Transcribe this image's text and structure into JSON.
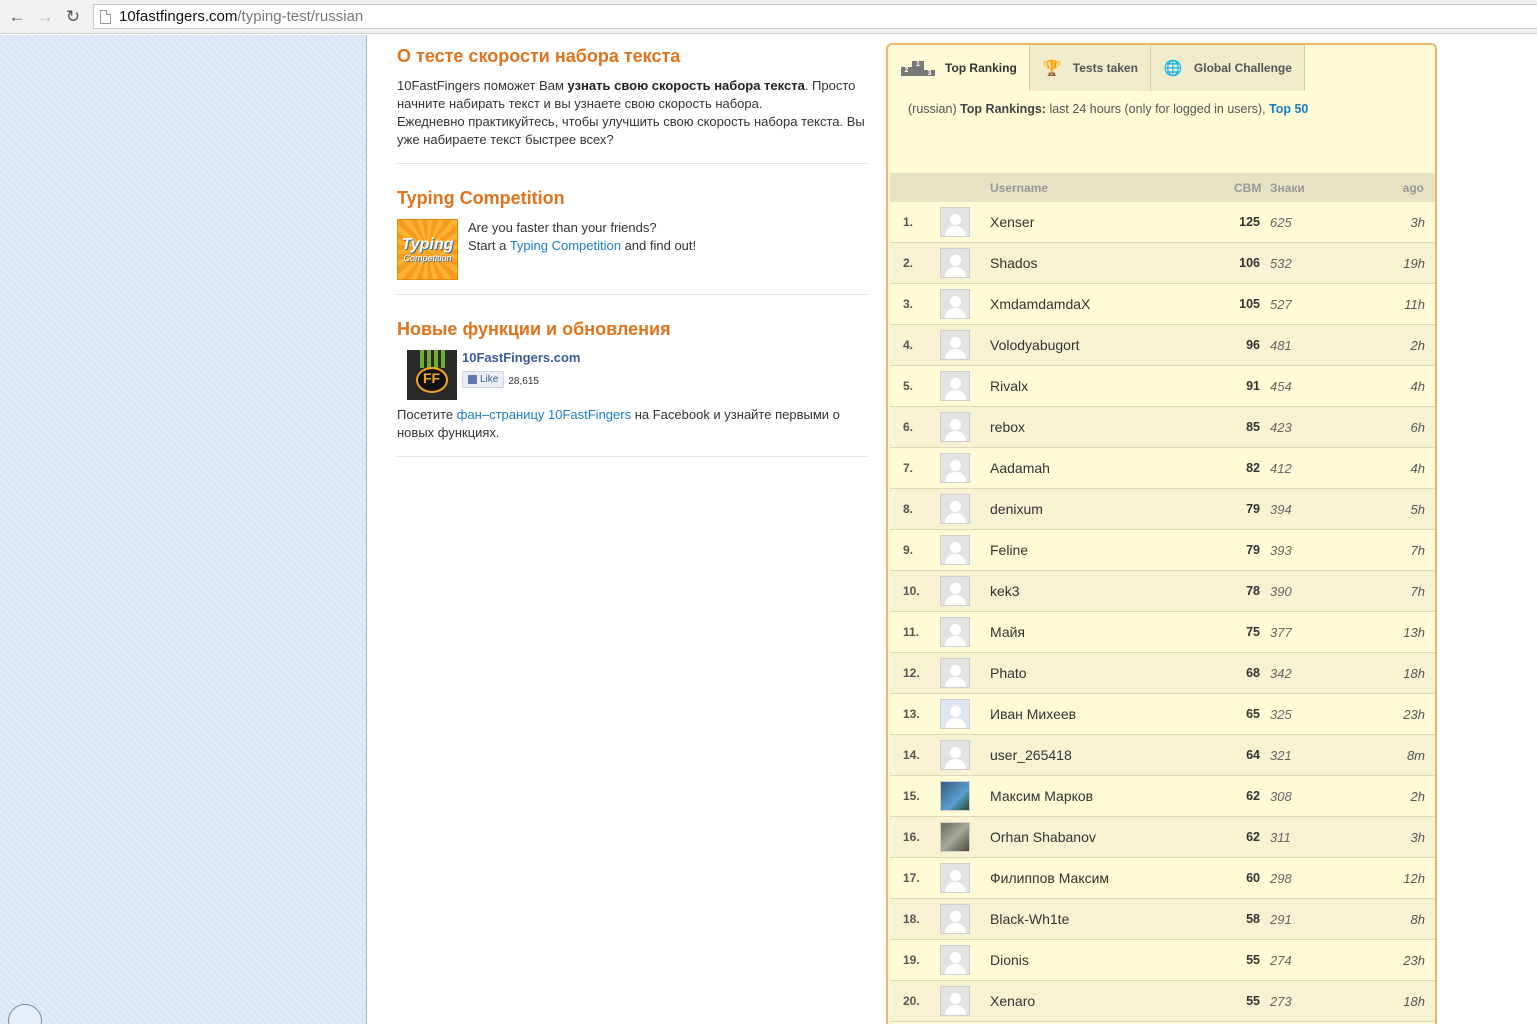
{
  "browser": {
    "url_host": "10fastfingers.com",
    "url_path": "/typing-test/russian"
  },
  "about": {
    "title": "О тесте скорости набора текста",
    "p1_start": "10FastFingers поможет Вам ",
    "p1_bold": "узнать свою скорость набора текста",
    "p1_end": ". Просто начните набирать текст и вы узнаете свою скорость набора.",
    "p2": "Ежедневно практикуйтесь, чтобы улучшить свою скорость набора текста. Вы уже набираете текст быстрее всех?"
  },
  "competition": {
    "title": "Typing Competition",
    "logo_line1": "Typing",
    "logo_line2": "Competition",
    "line1": "Are you faster than your friends?",
    "line2_start": "Start a ",
    "line2_link": "Typing Competition",
    "line2_end": " and find out!"
  },
  "updates": {
    "title": "Новые функции и обновления",
    "fb_page": "10FastFingers.com",
    "like_label": "Like",
    "like_count": "28,615",
    "text_start": "Посетите ",
    "text_link": "фан–страницу 10FastFingers",
    "text_end": " на Facebook и узнайте первыми о новых функциях."
  },
  "ranking": {
    "tabs": [
      {
        "label": "Top Ranking",
        "icon": "podium-icon"
      },
      {
        "label": "Tests taken",
        "icon": "trophy-icon"
      },
      {
        "label": "Global Challenge",
        "icon": "globe-icon"
      }
    ],
    "info_prefix": "(russian) ",
    "info_bold": "Top Rankings:",
    "info_text": " last 24 hours (only for logged in users), ",
    "info_link": "Top 50",
    "headers": {
      "username": "Username",
      "cbm": "СВМ",
      "chars": "Знаки",
      "ago": "ago"
    },
    "rows": [
      {
        "rank": "1.",
        "user": "Xenser",
        "cbm": "125",
        "chars": "625",
        "ago": "3h",
        "avatar": "default"
      },
      {
        "rank": "2.",
        "user": "Shados",
        "cbm": "106",
        "chars": "532",
        "ago": "19h",
        "avatar": "default"
      },
      {
        "rank": "3.",
        "user": "XmdamdamdaX",
        "cbm": "105",
        "chars": "527",
        "ago": "11h",
        "avatar": "default"
      },
      {
        "rank": "4.",
        "user": "Volodyabugort",
        "cbm": "96",
        "chars": "481",
        "ago": "2h",
        "avatar": "default"
      },
      {
        "rank": "5.",
        "user": "Rivalx",
        "cbm": "91",
        "chars": "454",
        "ago": "4h",
        "avatar": "default"
      },
      {
        "rank": "6.",
        "user": "rebox",
        "cbm": "85",
        "chars": "423",
        "ago": "6h",
        "avatar": "default"
      },
      {
        "rank": "7.",
        "user": "Aadamah",
        "cbm": "82",
        "chars": "412",
        "ago": "4h",
        "avatar": "default"
      },
      {
        "rank": "8.",
        "user": "denixum",
        "cbm": "79",
        "chars": "394",
        "ago": "5h",
        "avatar": "default"
      },
      {
        "rank": "9.",
        "user": "Feline",
        "cbm": "79",
        "chars": "393",
        "ago": "7h",
        "avatar": "default"
      },
      {
        "rank": "10.",
        "user": "kek3",
        "cbm": "78",
        "chars": "390",
        "ago": "7h",
        "avatar": "default"
      },
      {
        "rank": "11.",
        "user": "Майя",
        "cbm": "75",
        "chars": "377",
        "ago": "13h",
        "avatar": "default"
      },
      {
        "rank": "12.",
        "user": "Phato",
        "cbm": "68",
        "chars": "342",
        "ago": "18h",
        "avatar": "default"
      },
      {
        "rank": "13.",
        "user": "Иван Михеев",
        "cbm": "65",
        "chars": "325",
        "ago": "23h",
        "avatar": "photo3"
      },
      {
        "rank": "14.",
        "user": "user_265418",
        "cbm": "64",
        "chars": "321",
        "ago": "8m",
        "avatar": "default"
      },
      {
        "rank": "15.",
        "user": "Максим Марков",
        "cbm": "62",
        "chars": "308",
        "ago": "2h",
        "avatar": "photo1"
      },
      {
        "rank": "16.",
        "user": "Orhan Shabanov",
        "cbm": "62",
        "chars": "311",
        "ago": "3h",
        "avatar": "photo2"
      },
      {
        "rank": "17.",
        "user": "Филиппов Максим",
        "cbm": "60",
        "chars": "298",
        "ago": "12h",
        "avatar": "default"
      },
      {
        "rank": "18.",
        "user": "Black-Wh1te",
        "cbm": "58",
        "chars": "291",
        "ago": "8h",
        "avatar": "default"
      },
      {
        "rank": "19.",
        "user": "Dionis",
        "cbm": "55",
        "chars": "274",
        "ago": "23h",
        "avatar": "default"
      },
      {
        "rank": "20.",
        "user": "Xenaro",
        "cbm": "55",
        "chars": "273",
        "ago": "18h",
        "avatar": "default"
      }
    ]
  },
  "colors": {
    "accent": "#e0731b",
    "link": "#1a7dc4",
    "panel": "#fffbd6",
    "panel_border": "#e9b567"
  }
}
